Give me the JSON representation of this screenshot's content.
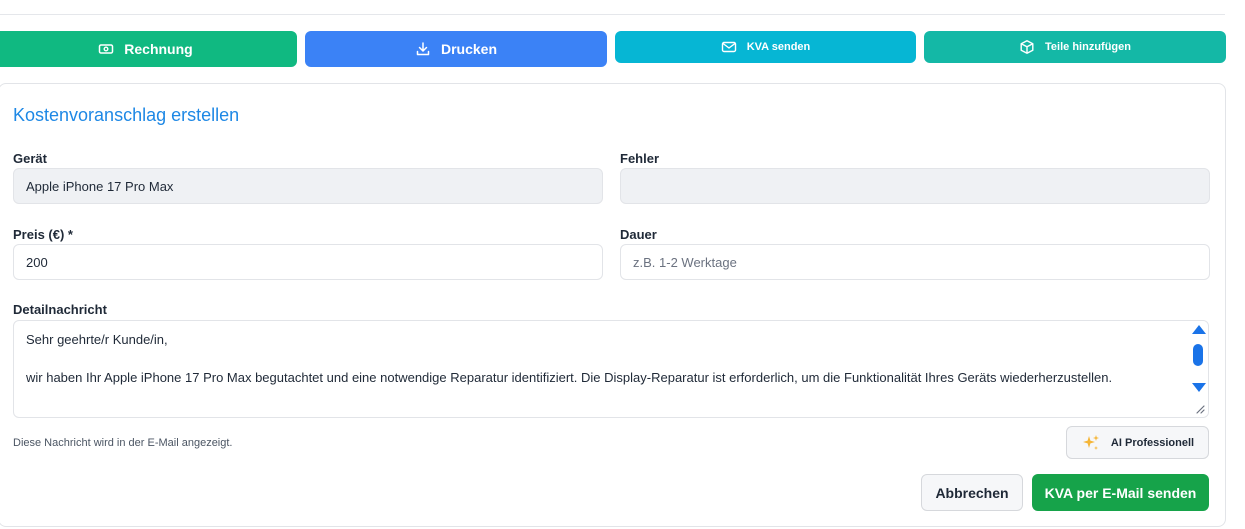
{
  "actions": {
    "invoice_label": "Rechnung",
    "print_label": "Drucken",
    "kva_send_label": "KVA senden",
    "add_parts_label": "Teile hinzufügen"
  },
  "form": {
    "title": "Kostenvoranschlag erstellen",
    "device": {
      "label": "Gerät",
      "value": "Apple iPhone 17 Pro Max"
    },
    "error": {
      "label": "Fehler",
      "value": ""
    },
    "price": {
      "label": "Preis (€) *",
      "value": "200"
    },
    "duration": {
      "label": "Dauer",
      "placeholder": "z.B. 1-2 Werktage"
    },
    "message": {
      "label": "Detailnachricht",
      "line1": "Sehr geehrte/r Kunde/in,",
      "line2": "wir haben Ihr Apple iPhone 17 Pro Max begutachtet und eine notwendige Reparatur identifiziert. Die Display-Reparatur ist erforderlich, um die Funktionalität Ihres Geräts wiederherzustellen."
    },
    "helper_text": "Diese Nachricht wird in der E-Mail angezeigt.",
    "ai_button_label": "AI Professionell",
    "cancel_label": "Abbrechen",
    "submit_label": "KVA per E-Mail senden"
  },
  "colors": {
    "invoice": "#10b981",
    "print": "#3b82f6",
    "kva_send": "#06b6d4",
    "add_parts": "#14b8a6",
    "title_blue": "#1e88e5",
    "submit_green": "#16a34a"
  },
  "icons": {
    "invoice": "banknote-icon",
    "print": "download-icon",
    "kva_send": "mail-icon",
    "add_parts": "package-icon",
    "ai": "sparkles-icon"
  }
}
